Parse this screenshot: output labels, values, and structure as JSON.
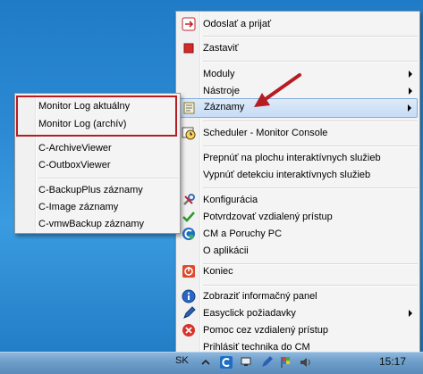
{
  "main_menu": {
    "items": [
      {
        "label": "Odoslať a prijať",
        "icon": "send-receive-icon"
      },
      {
        "label": "Zastaviť",
        "icon": "stop-icon"
      },
      {
        "label": "Moduly",
        "submenu": true
      },
      {
        "label": "Nástroje",
        "submenu": true
      },
      {
        "label": "Záznamy",
        "icon": "records-icon",
        "submenu": true
      },
      {
        "label": "Scheduler - Monitor Console",
        "icon": "scheduler-icon"
      },
      {
        "label": "Prepnúť na plochu interaktívnych služieb"
      },
      {
        "label": "Vypnúť detekciu interaktívnych služieb"
      },
      {
        "label": "Konfigurácia",
        "icon": "tools-icon"
      },
      {
        "label": "Potvrdzovať vzdialený prístup",
        "icon": "checkmark-icon"
      },
      {
        "label": "CM a Poruchy PC",
        "icon": "cm-icon"
      },
      {
        "label": "O aplikácii"
      },
      {
        "label": "Koniec",
        "icon": "exit-icon"
      },
      {
        "label": "Zobraziť informačný panel",
        "icon": "info-icon"
      },
      {
        "label": "Easyclick požiadavky",
        "icon": "pen-icon",
        "submenu": true
      },
      {
        "label": "Pomoc cez vzdialený prístup",
        "icon": "help-icon"
      },
      {
        "label": "Prihlásiť technika do CM"
      }
    ]
  },
  "sub_menu": {
    "items": [
      {
        "label": "Monitor Log aktuálny"
      },
      {
        "label": "Monitor Log (archív)"
      },
      {
        "label": "C-ArchiveViewer"
      },
      {
        "label": "C-OutboxViewer"
      },
      {
        "label": "C-BackupPlus záznamy"
      },
      {
        "label": "C-Image záznamy"
      },
      {
        "label": "C-vmwBackup záznamy"
      }
    ]
  },
  "taskbar": {
    "lang": "SK",
    "clock": "15:17"
  },
  "colors": {
    "accent_red": "#b51d22",
    "highlight": "#c7dcf5"
  }
}
